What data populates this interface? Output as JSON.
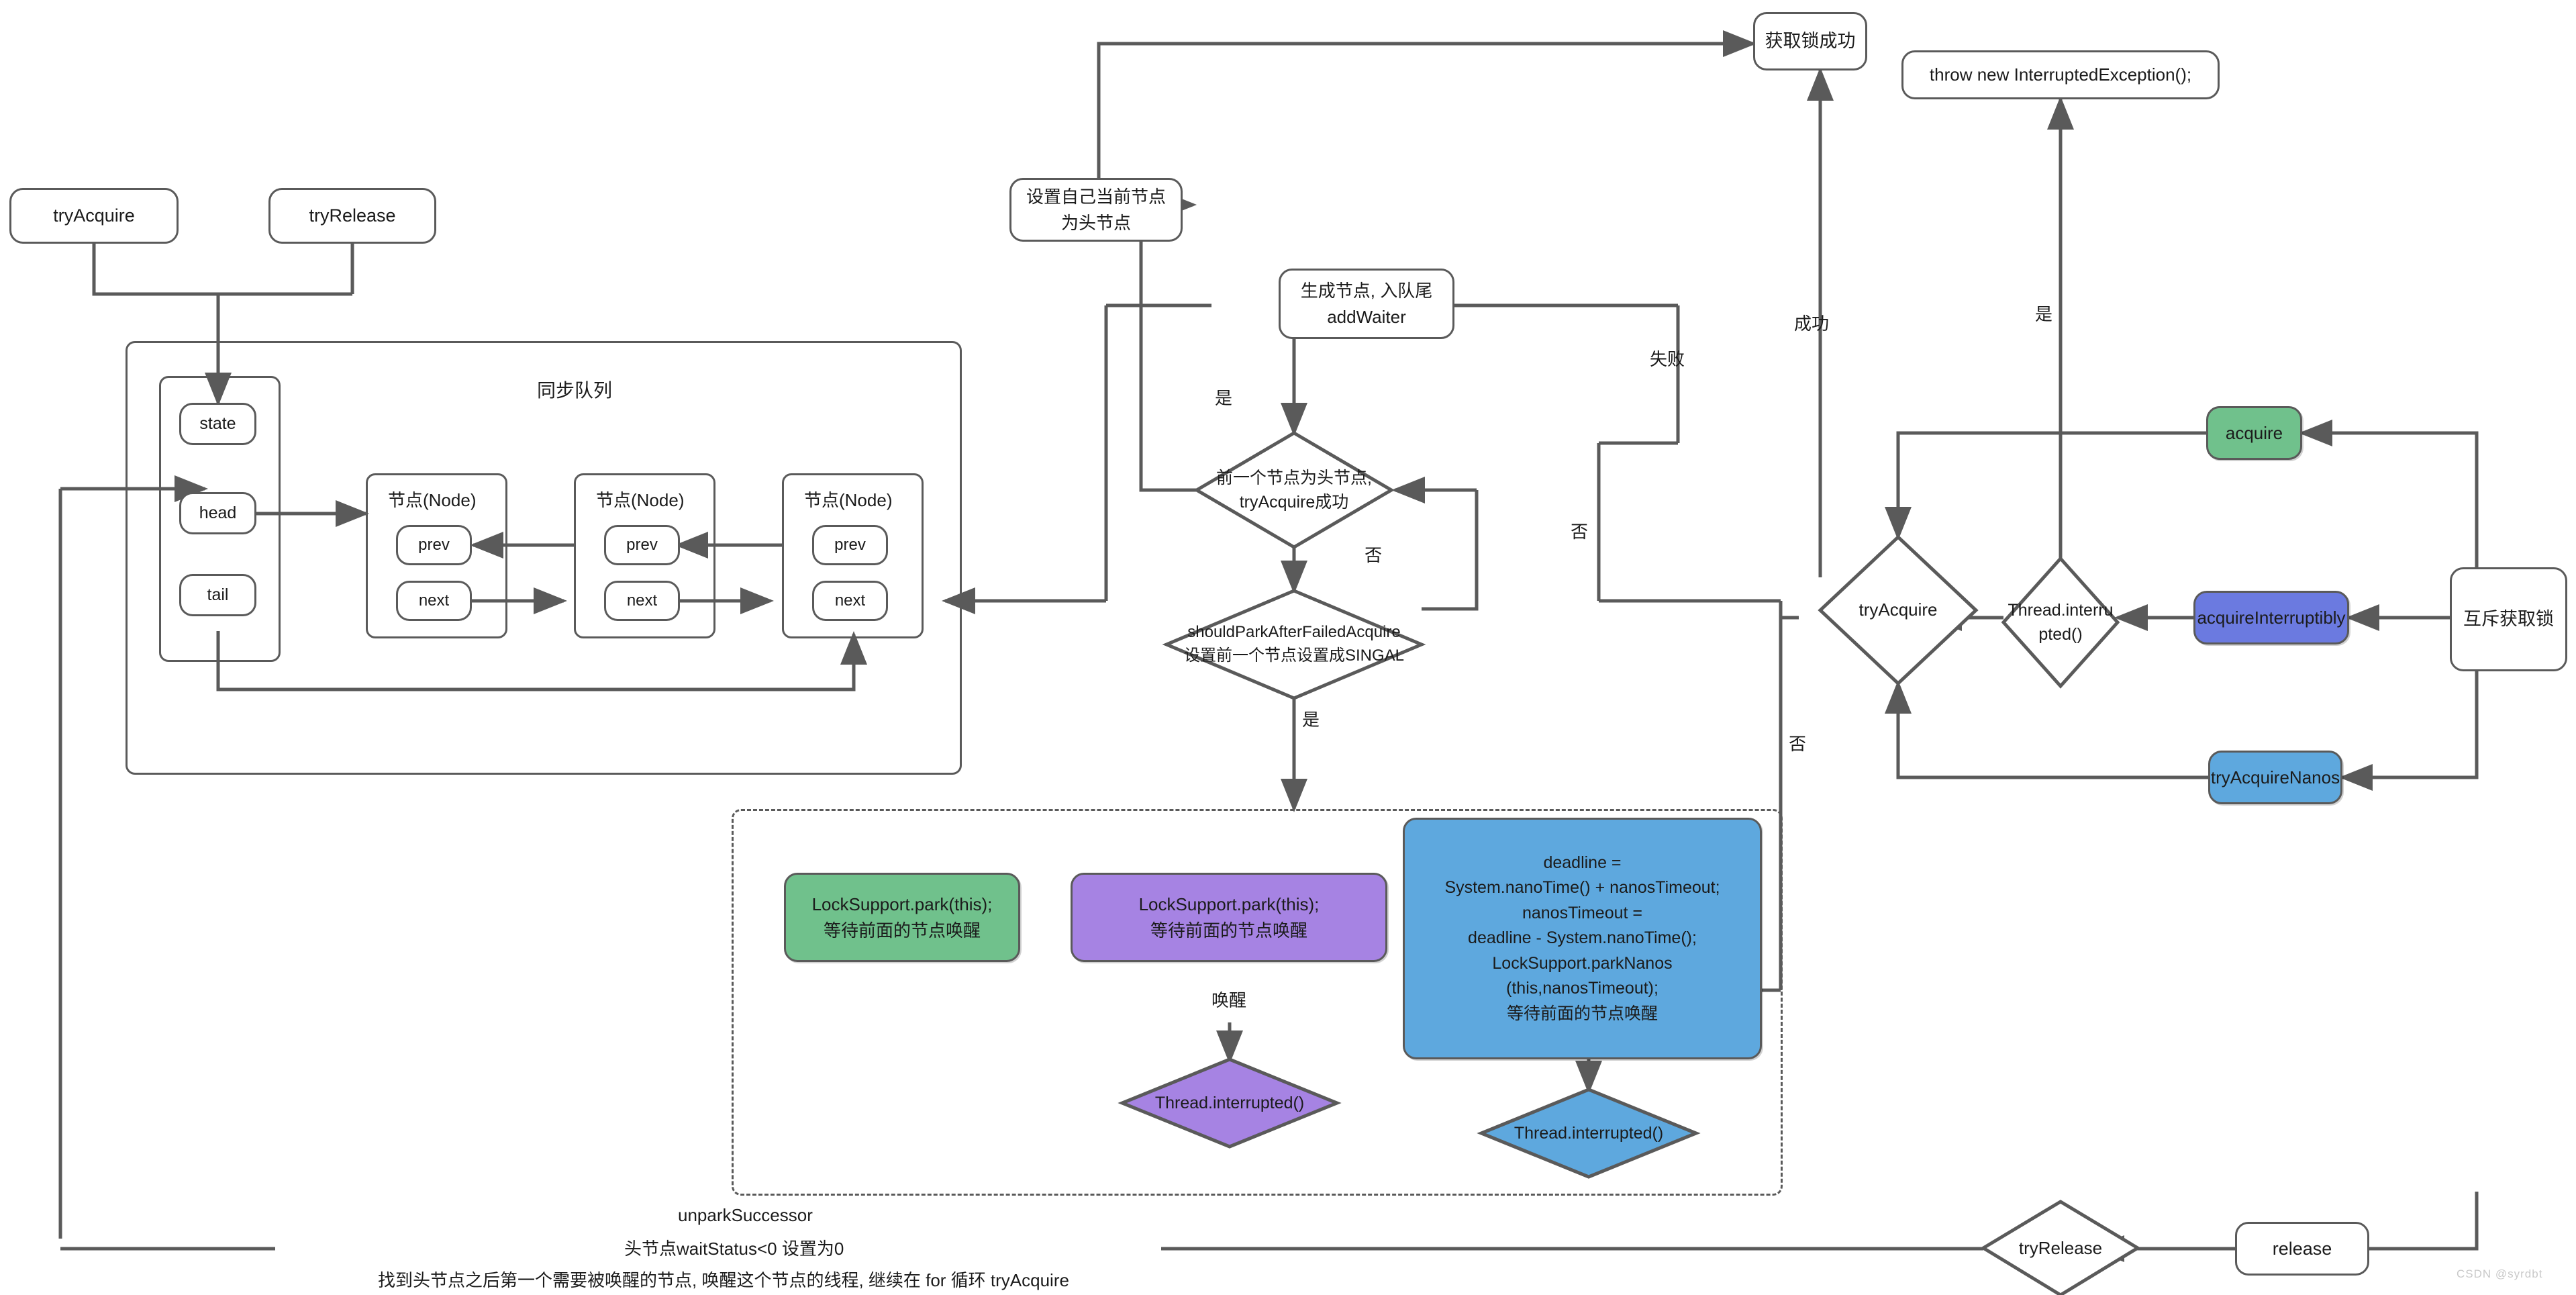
{
  "title": "AQS 同步队列与锁获取流程图",
  "watermark": "CSDN @syrdbt",
  "colors": {
    "stroke": "#5a5a5a",
    "text": "#1b1b1b",
    "green": "#70c18c",
    "purple": "#a683e3",
    "blue": "#5ea8de",
    "indigo": "#6b7ae0",
    "lightblue": "#5ea8de",
    "white": "#ffffff"
  },
  "nodes": {
    "try_acquire_top": "tryAcquire",
    "try_release_top": "tryRelease",
    "sync_queue_title": "同步队列",
    "state": "state",
    "head": "head",
    "tail": "tail",
    "node_label": "节点(Node)",
    "prev": "prev",
    "next": "next",
    "set_head_l1": "设置自己当前节点",
    "set_head_l2": "为头节点",
    "acquire_success": "获取锁成功",
    "throw_interrupted": "throw new InterruptedException();",
    "add_waiter_l1": "生成节点, 入队尾",
    "add_waiter_l2": "addWaiter",
    "pred_is_head_l1": "前一个节点为头节点,",
    "pred_is_head_l2": "tryAcquire成功",
    "should_park_l1": "shouldParkAfterFailedAcquire",
    "should_park_l2": "设置前一个节点设置成SINGAL",
    "acquire": "acquire",
    "acquire_interruptibly": "acquireInterruptibly",
    "try_acquire_nanos": "tryAcquireNanos",
    "mutex_acquire": "互斥获取锁",
    "try_acquire_diamond": "tryAcquire",
    "thread_interrupted_l1": "Thread.interru",
    "thread_interrupted_l2": "pted()",
    "park_green_l1": "LockSupport.park(this);",
    "park_green_l2": "等待前面的节点唤醒",
    "park_purple_l1": "LockSupport.park(this);",
    "park_purple_l2": "等待前面的节点唤醒",
    "park_nanos_l1": "deadline =",
    "park_nanos_l2": "System.nanoTime() + nanosTimeout;",
    "park_nanos_l3": "nanosTimeout =",
    "park_nanos_l4": "deadline - System.nanoTime();",
    "park_nanos_l5": "LockSupport.parkNanos",
    "park_nanos_l6": "(this,nanosTimeout);",
    "park_nanos_l7": "等待前面的节点唤醒",
    "thread_interrupted_purple": "Thread.interrupted()",
    "thread_interrupted_blue": "Thread.interrupted()",
    "try_release_diamond": "tryRelease",
    "release": "release",
    "unpark_l1": "unparkSuccessor",
    "unpark_l2": "头节点waitStatus<0 设置为0",
    "unpark_l3": "找到头节点之后第一个需要被唤醒的节点, 唤醒这个节点的线程, 继续在 for 循环 tryAcquire"
  },
  "edge_labels": {
    "yes_1": "是",
    "no_1": "否",
    "no_2": "否",
    "yes_2": "是",
    "fail": "失败",
    "success": "成功",
    "yes_3": "是",
    "no_3": "否",
    "wake": "唤醒"
  }
}
